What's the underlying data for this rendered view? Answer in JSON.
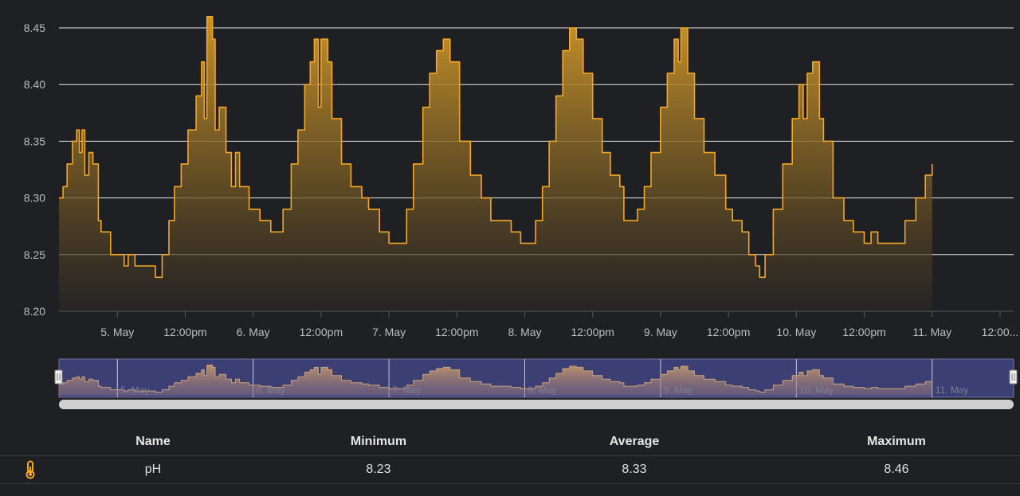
{
  "chart_data": {
    "type": "area",
    "y_ticks": [
      "8.20",
      "8.25",
      "8.30",
      "8.35",
      "8.40",
      "8.45"
    ],
    "ylim": [
      8.2,
      8.46
    ],
    "x_tick_labels": [
      "5. May",
      "12:00pm",
      "6. May",
      "12:00pm",
      "7. May",
      "12:00pm",
      "8. May",
      "12:00pm",
      "9. May",
      "12:00pm",
      "10. May",
      "12:00pm",
      "11. May",
      "12:00..."
    ],
    "navigator_labels": [
      "5. May",
      "6. May",
      "7. May",
      "8. May",
      "9. May",
      "10. May",
      "11. May"
    ],
    "xlim_days": [
      4.57,
      11.6
    ],
    "series": [
      {
        "color": "#f5a623",
        "points": [
          [
            4.57,
            8.3
          ],
          [
            4.6,
            8.31
          ],
          [
            4.63,
            8.33
          ],
          [
            4.67,
            8.35
          ],
          [
            4.7,
            8.36
          ],
          [
            4.72,
            8.34
          ],
          [
            4.74,
            8.36
          ],
          [
            4.76,
            8.32
          ],
          [
            4.79,
            8.34
          ],
          [
            4.82,
            8.33
          ],
          [
            4.86,
            8.28
          ],
          [
            4.88,
            8.27
          ],
          [
            4.95,
            8.25
          ],
          [
            5.0,
            8.25
          ],
          [
            5.05,
            8.24
          ],
          [
            5.08,
            8.25
          ],
          [
            5.13,
            8.24
          ],
          [
            5.28,
            8.23
          ],
          [
            5.33,
            8.25
          ],
          [
            5.38,
            8.28
          ],
          [
            5.42,
            8.31
          ],
          [
            5.47,
            8.33
          ],
          [
            5.52,
            8.36
          ],
          [
            5.58,
            8.39
          ],
          [
            5.62,
            8.42
          ],
          [
            5.64,
            8.37
          ],
          [
            5.66,
            8.46
          ],
          [
            5.7,
            8.44
          ],
          [
            5.72,
            8.36
          ],
          [
            5.75,
            8.38
          ],
          [
            5.8,
            8.34
          ],
          [
            5.84,
            8.31
          ],
          [
            5.87,
            8.34
          ],
          [
            5.9,
            8.31
          ],
          [
            5.97,
            8.29
          ],
          [
            6.05,
            8.28
          ],
          [
            6.13,
            8.27
          ],
          [
            6.22,
            8.29
          ],
          [
            6.28,
            8.33
          ],
          [
            6.33,
            8.36
          ],
          [
            6.38,
            8.4
          ],
          [
            6.42,
            8.42
          ],
          [
            6.45,
            8.44
          ],
          [
            6.48,
            8.38
          ],
          [
            6.5,
            8.44
          ],
          [
            6.55,
            8.42
          ],
          [
            6.58,
            8.37
          ],
          [
            6.65,
            8.33
          ],
          [
            6.72,
            8.31
          ],
          [
            6.8,
            8.3
          ],
          [
            6.85,
            8.29
          ],
          [
            6.93,
            8.27
          ],
          [
            7.0,
            8.26
          ],
          [
            7.08,
            8.26
          ],
          [
            7.13,
            8.29
          ],
          [
            7.18,
            8.33
          ],
          [
            7.25,
            8.38
          ],
          [
            7.3,
            8.41
          ],
          [
            7.35,
            8.43
          ],
          [
            7.4,
            8.44
          ],
          [
            7.45,
            8.42
          ],
          [
            7.52,
            8.35
          ],
          [
            7.6,
            8.32
          ],
          [
            7.68,
            8.3
          ],
          [
            7.75,
            8.28
          ],
          [
            7.83,
            8.28
          ],
          [
            7.9,
            8.27
          ],
          [
            7.97,
            8.26
          ],
          [
            8.03,
            8.26
          ],
          [
            8.08,
            8.28
          ],
          [
            8.13,
            8.31
          ],
          [
            8.18,
            8.35
          ],
          [
            8.23,
            8.39
          ],
          [
            8.28,
            8.43
          ],
          [
            8.33,
            8.45
          ],
          [
            8.38,
            8.44
          ],
          [
            8.43,
            8.41
          ],
          [
            8.5,
            8.37
          ],
          [
            8.57,
            8.34
          ],
          [
            8.63,
            8.32
          ],
          [
            8.7,
            8.31
          ],
          [
            8.73,
            8.28
          ],
          [
            8.8,
            8.28
          ],
          [
            8.83,
            8.29
          ],
          [
            8.88,
            8.31
          ],
          [
            8.93,
            8.34
          ],
          [
            9.0,
            8.38
          ],
          [
            9.05,
            8.41
          ],
          [
            9.1,
            8.44
          ],
          [
            9.13,
            8.42
          ],
          [
            9.15,
            8.45
          ],
          [
            9.2,
            8.41
          ],
          [
            9.25,
            8.37
          ],
          [
            9.32,
            8.34
          ],
          [
            9.4,
            8.32
          ],
          [
            9.48,
            8.29
          ],
          [
            9.53,
            8.28
          ],
          [
            9.6,
            8.27
          ],
          [
            9.65,
            8.25
          ],
          [
            9.7,
            8.24
          ],
          [
            9.73,
            8.23
          ],
          [
            9.77,
            8.25
          ],
          [
            9.83,
            8.29
          ],
          [
            9.9,
            8.33
          ],
          [
            9.97,
            8.37
          ],
          [
            10.02,
            8.4
          ],
          [
            10.05,
            8.37
          ],
          [
            10.08,
            8.41
          ],
          [
            10.12,
            8.42
          ],
          [
            10.17,
            8.37
          ],
          [
            10.2,
            8.35
          ],
          [
            10.27,
            8.3
          ],
          [
            10.35,
            8.28
          ],
          [
            10.42,
            8.27
          ],
          [
            10.5,
            8.26
          ],
          [
            10.55,
            8.27
          ],
          [
            10.6,
            8.26
          ],
          [
            10.7,
            8.26
          ],
          [
            10.75,
            8.26
          ],
          [
            10.8,
            8.28
          ],
          [
            10.88,
            8.3
          ],
          [
            10.95,
            8.32
          ],
          [
            11.0,
            8.33
          ]
        ]
      }
    ]
  },
  "stats_table": {
    "headers": {
      "name": "Name",
      "minimum": "Minimum",
      "average": "Average",
      "maximum": "Maximum"
    },
    "rows": [
      {
        "icon": "thermometer-icon",
        "name": "pH",
        "minimum": "8.23",
        "average": "8.33",
        "maximum": "8.46"
      }
    ]
  }
}
